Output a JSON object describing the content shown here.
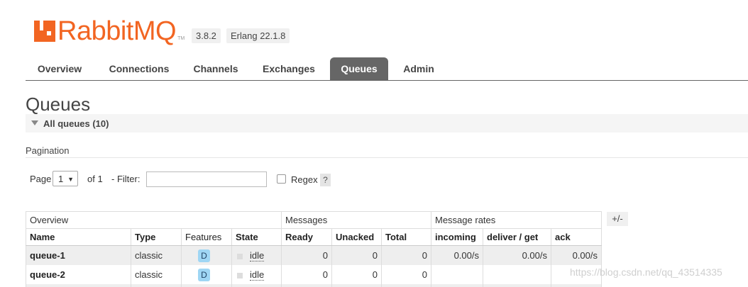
{
  "header": {
    "logo_rabbit": "Rabbit",
    "logo_mq": "MQ",
    "logo_tm": "TM",
    "version": "3.8.2",
    "erlang": "Erlang 22.1.8"
  },
  "tabs": [
    {
      "label": "Overview"
    },
    {
      "label": "Connections"
    },
    {
      "label": "Channels"
    },
    {
      "label": "Exchanges"
    },
    {
      "label": "Queues",
      "active": true
    },
    {
      "label": "Admin"
    }
  ],
  "page": {
    "title": "Queues",
    "section_label": "All queues (10)",
    "pagination_label": "Pagination"
  },
  "pagination": {
    "page_label": "Page",
    "page_value": "1",
    "of_label": "of 1",
    "filter_label": "- Filter:",
    "filter_value": "",
    "regex_label": "Regex",
    "help_label": "?"
  },
  "table": {
    "groups": [
      "Overview",
      "Messages",
      "Message rates"
    ],
    "columns": [
      "Name",
      "Type",
      "Features",
      "State",
      "Ready",
      "Unacked",
      "Total",
      "incoming",
      "deliver / get",
      "ack"
    ],
    "toggle_label": "+/-",
    "rows": [
      {
        "name": "queue-1",
        "type": "classic",
        "feature": "D",
        "state": "idle",
        "ready": "0",
        "unacked": "0",
        "total": "0",
        "incoming": "0.00/s",
        "deliver": "0.00/s",
        "ack": "0.00/s"
      },
      {
        "name": "queue-2",
        "type": "classic",
        "feature": "D",
        "state": "idle",
        "ready": "0",
        "unacked": "0",
        "total": "0",
        "incoming": "",
        "deliver": "",
        "ack": ""
      }
    ]
  },
  "watermark": "https://blog.csdn.net/qq_43514335",
  "colors": {
    "brand": "#f26522",
    "active_tab": "#666666",
    "badge": "#9fd6f4"
  }
}
